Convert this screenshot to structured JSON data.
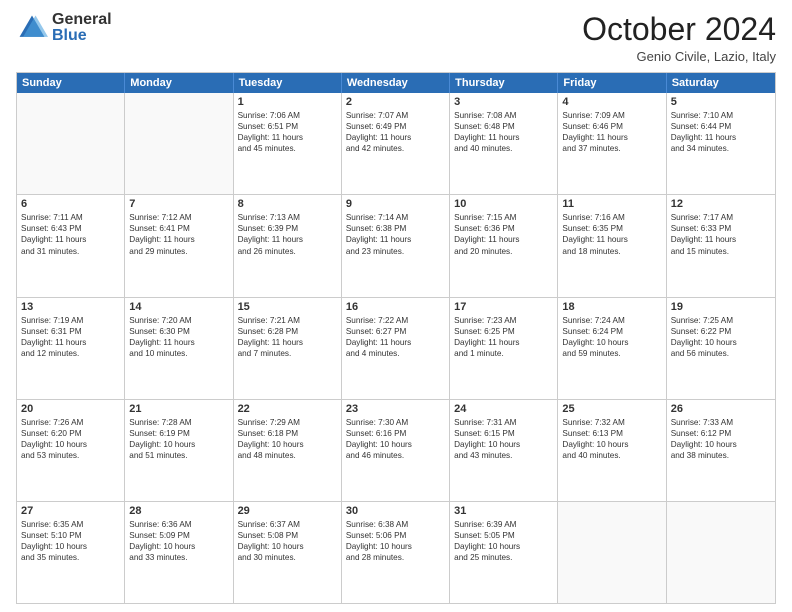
{
  "logo": {
    "general": "General",
    "blue": "Blue"
  },
  "title": "October 2024",
  "subtitle": "Genio Civile, Lazio, Italy",
  "days": [
    "Sunday",
    "Monday",
    "Tuesday",
    "Wednesday",
    "Thursday",
    "Friday",
    "Saturday"
  ],
  "weeks": [
    [
      {
        "day": "",
        "empty": true
      },
      {
        "day": "",
        "empty": true
      },
      {
        "day": "1",
        "lines": [
          "Sunrise: 7:06 AM",
          "Sunset: 6:51 PM",
          "Daylight: 11 hours",
          "and 45 minutes."
        ]
      },
      {
        "day": "2",
        "lines": [
          "Sunrise: 7:07 AM",
          "Sunset: 6:49 PM",
          "Daylight: 11 hours",
          "and 42 minutes."
        ]
      },
      {
        "day": "3",
        "lines": [
          "Sunrise: 7:08 AM",
          "Sunset: 6:48 PM",
          "Daylight: 11 hours",
          "and 40 minutes."
        ]
      },
      {
        "day": "4",
        "lines": [
          "Sunrise: 7:09 AM",
          "Sunset: 6:46 PM",
          "Daylight: 11 hours",
          "and 37 minutes."
        ]
      },
      {
        "day": "5",
        "lines": [
          "Sunrise: 7:10 AM",
          "Sunset: 6:44 PM",
          "Daylight: 11 hours",
          "and 34 minutes."
        ]
      }
    ],
    [
      {
        "day": "6",
        "lines": [
          "Sunrise: 7:11 AM",
          "Sunset: 6:43 PM",
          "Daylight: 11 hours",
          "and 31 minutes."
        ]
      },
      {
        "day": "7",
        "lines": [
          "Sunrise: 7:12 AM",
          "Sunset: 6:41 PM",
          "Daylight: 11 hours",
          "and 29 minutes."
        ]
      },
      {
        "day": "8",
        "lines": [
          "Sunrise: 7:13 AM",
          "Sunset: 6:39 PM",
          "Daylight: 11 hours",
          "and 26 minutes."
        ]
      },
      {
        "day": "9",
        "lines": [
          "Sunrise: 7:14 AM",
          "Sunset: 6:38 PM",
          "Daylight: 11 hours",
          "and 23 minutes."
        ]
      },
      {
        "day": "10",
        "lines": [
          "Sunrise: 7:15 AM",
          "Sunset: 6:36 PM",
          "Daylight: 11 hours",
          "and 20 minutes."
        ]
      },
      {
        "day": "11",
        "lines": [
          "Sunrise: 7:16 AM",
          "Sunset: 6:35 PM",
          "Daylight: 11 hours",
          "and 18 minutes."
        ]
      },
      {
        "day": "12",
        "lines": [
          "Sunrise: 7:17 AM",
          "Sunset: 6:33 PM",
          "Daylight: 11 hours",
          "and 15 minutes."
        ]
      }
    ],
    [
      {
        "day": "13",
        "lines": [
          "Sunrise: 7:19 AM",
          "Sunset: 6:31 PM",
          "Daylight: 11 hours",
          "and 12 minutes."
        ]
      },
      {
        "day": "14",
        "lines": [
          "Sunrise: 7:20 AM",
          "Sunset: 6:30 PM",
          "Daylight: 11 hours",
          "and 10 minutes."
        ]
      },
      {
        "day": "15",
        "lines": [
          "Sunrise: 7:21 AM",
          "Sunset: 6:28 PM",
          "Daylight: 11 hours",
          "and 7 minutes."
        ]
      },
      {
        "day": "16",
        "lines": [
          "Sunrise: 7:22 AM",
          "Sunset: 6:27 PM",
          "Daylight: 11 hours",
          "and 4 minutes."
        ]
      },
      {
        "day": "17",
        "lines": [
          "Sunrise: 7:23 AM",
          "Sunset: 6:25 PM",
          "Daylight: 11 hours",
          "and 1 minute."
        ]
      },
      {
        "day": "18",
        "lines": [
          "Sunrise: 7:24 AM",
          "Sunset: 6:24 PM",
          "Daylight: 10 hours",
          "and 59 minutes."
        ]
      },
      {
        "day": "19",
        "lines": [
          "Sunrise: 7:25 AM",
          "Sunset: 6:22 PM",
          "Daylight: 10 hours",
          "and 56 minutes."
        ]
      }
    ],
    [
      {
        "day": "20",
        "lines": [
          "Sunrise: 7:26 AM",
          "Sunset: 6:20 PM",
          "Daylight: 10 hours",
          "and 53 minutes."
        ]
      },
      {
        "day": "21",
        "lines": [
          "Sunrise: 7:28 AM",
          "Sunset: 6:19 PM",
          "Daylight: 10 hours",
          "and 51 minutes."
        ]
      },
      {
        "day": "22",
        "lines": [
          "Sunrise: 7:29 AM",
          "Sunset: 6:18 PM",
          "Daylight: 10 hours",
          "and 48 minutes."
        ]
      },
      {
        "day": "23",
        "lines": [
          "Sunrise: 7:30 AM",
          "Sunset: 6:16 PM",
          "Daylight: 10 hours",
          "and 46 minutes."
        ]
      },
      {
        "day": "24",
        "lines": [
          "Sunrise: 7:31 AM",
          "Sunset: 6:15 PM",
          "Daylight: 10 hours",
          "and 43 minutes."
        ]
      },
      {
        "day": "25",
        "lines": [
          "Sunrise: 7:32 AM",
          "Sunset: 6:13 PM",
          "Daylight: 10 hours",
          "and 40 minutes."
        ]
      },
      {
        "day": "26",
        "lines": [
          "Sunrise: 7:33 AM",
          "Sunset: 6:12 PM",
          "Daylight: 10 hours",
          "and 38 minutes."
        ]
      }
    ],
    [
      {
        "day": "27",
        "lines": [
          "Sunrise: 6:35 AM",
          "Sunset: 5:10 PM",
          "Daylight: 10 hours",
          "and 35 minutes."
        ]
      },
      {
        "day": "28",
        "lines": [
          "Sunrise: 6:36 AM",
          "Sunset: 5:09 PM",
          "Daylight: 10 hours",
          "and 33 minutes."
        ]
      },
      {
        "day": "29",
        "lines": [
          "Sunrise: 6:37 AM",
          "Sunset: 5:08 PM",
          "Daylight: 10 hours",
          "and 30 minutes."
        ]
      },
      {
        "day": "30",
        "lines": [
          "Sunrise: 6:38 AM",
          "Sunset: 5:06 PM",
          "Daylight: 10 hours",
          "and 28 minutes."
        ]
      },
      {
        "day": "31",
        "lines": [
          "Sunrise: 6:39 AM",
          "Sunset: 5:05 PM",
          "Daylight: 10 hours",
          "and 25 minutes."
        ]
      },
      {
        "day": "",
        "empty": true
      },
      {
        "day": "",
        "empty": true
      }
    ]
  ]
}
